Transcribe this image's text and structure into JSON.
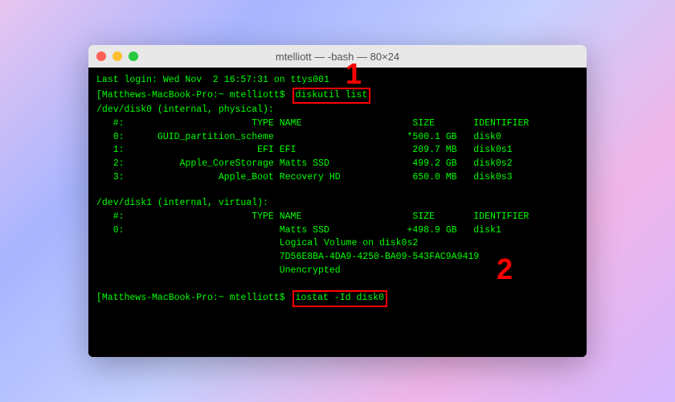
{
  "window": {
    "title": "mtelliott — -bash — 80×24"
  },
  "callouts": {
    "one": "1",
    "two": "2"
  },
  "terminal": {
    "login_line": "Last login: Wed Nov  2 16:57:31 on ttys001",
    "prompt1_prefix": "[Matthews-MacBook-Pro:~ mtelliott$",
    "cmd1": "diskutil list",
    "disk0_header": "/dev/disk0 (internal, physical):",
    "col_header": "   #:                       TYPE NAME                    SIZE       IDENTIFIER",
    "d0_r0": "   0:      GUID_partition_scheme                        *500.1 GB   disk0",
    "d0_r1": "   1:                        EFI EFI                     209.7 MB   disk0s1",
    "d0_r2": "   2:          Apple_CoreStorage Matts SSD               499.2 GB   disk0s2",
    "d0_r3": "   3:                 Apple_Boot Recovery HD             650.0 MB   disk0s3",
    "disk1_header": "/dev/disk1 (internal, virtual):",
    "col_header2": "   #:                       TYPE NAME                    SIZE       IDENTIFIER",
    "d1_r0": "   0:                            Matts SSD              +498.9 GB   disk1",
    "d1_lv": "                                 Logical Volume on disk0s2",
    "d1_uuid": "                                 7D56E8BA-4DA9-4250-BA09-543FAC9A9419",
    "d1_enc": "                                 Unencrypted",
    "prompt2_prefix": "[Matthews-MacBook-Pro:~ mtelliott$",
    "cmd2": "iostat -Id disk0"
  }
}
